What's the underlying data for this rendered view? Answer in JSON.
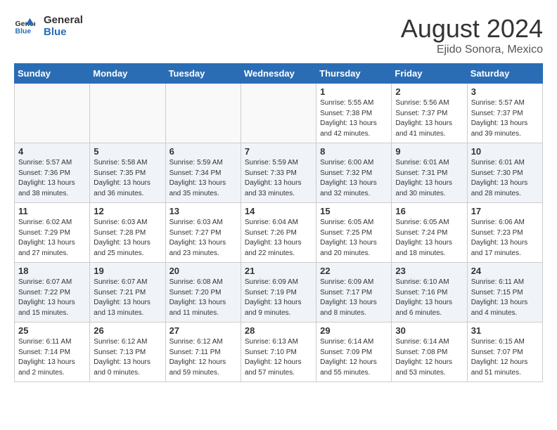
{
  "header": {
    "logo_line1": "General",
    "logo_line2": "Blue",
    "month_year": "August 2024",
    "location": "Ejido Sonora, Mexico"
  },
  "days_of_week": [
    "Sunday",
    "Monday",
    "Tuesday",
    "Wednesday",
    "Thursday",
    "Friday",
    "Saturday"
  ],
  "weeks": [
    [
      {
        "day": "",
        "info": ""
      },
      {
        "day": "",
        "info": ""
      },
      {
        "day": "",
        "info": ""
      },
      {
        "day": "",
        "info": ""
      },
      {
        "day": "1",
        "info": "Sunrise: 5:55 AM\nSunset: 7:38 PM\nDaylight: 13 hours\nand 42 minutes."
      },
      {
        "day": "2",
        "info": "Sunrise: 5:56 AM\nSunset: 7:37 PM\nDaylight: 13 hours\nand 41 minutes."
      },
      {
        "day": "3",
        "info": "Sunrise: 5:57 AM\nSunset: 7:37 PM\nDaylight: 13 hours\nand 39 minutes."
      }
    ],
    [
      {
        "day": "4",
        "info": "Sunrise: 5:57 AM\nSunset: 7:36 PM\nDaylight: 13 hours\nand 38 minutes."
      },
      {
        "day": "5",
        "info": "Sunrise: 5:58 AM\nSunset: 7:35 PM\nDaylight: 13 hours\nand 36 minutes."
      },
      {
        "day": "6",
        "info": "Sunrise: 5:59 AM\nSunset: 7:34 PM\nDaylight: 13 hours\nand 35 minutes."
      },
      {
        "day": "7",
        "info": "Sunrise: 5:59 AM\nSunset: 7:33 PM\nDaylight: 13 hours\nand 33 minutes."
      },
      {
        "day": "8",
        "info": "Sunrise: 6:00 AM\nSunset: 7:32 PM\nDaylight: 13 hours\nand 32 minutes."
      },
      {
        "day": "9",
        "info": "Sunrise: 6:01 AM\nSunset: 7:31 PM\nDaylight: 13 hours\nand 30 minutes."
      },
      {
        "day": "10",
        "info": "Sunrise: 6:01 AM\nSunset: 7:30 PM\nDaylight: 13 hours\nand 28 minutes."
      }
    ],
    [
      {
        "day": "11",
        "info": "Sunrise: 6:02 AM\nSunset: 7:29 PM\nDaylight: 13 hours\nand 27 minutes."
      },
      {
        "day": "12",
        "info": "Sunrise: 6:03 AM\nSunset: 7:28 PM\nDaylight: 13 hours\nand 25 minutes."
      },
      {
        "day": "13",
        "info": "Sunrise: 6:03 AM\nSunset: 7:27 PM\nDaylight: 13 hours\nand 23 minutes."
      },
      {
        "day": "14",
        "info": "Sunrise: 6:04 AM\nSunset: 7:26 PM\nDaylight: 13 hours\nand 22 minutes."
      },
      {
        "day": "15",
        "info": "Sunrise: 6:05 AM\nSunset: 7:25 PM\nDaylight: 13 hours\nand 20 minutes."
      },
      {
        "day": "16",
        "info": "Sunrise: 6:05 AM\nSunset: 7:24 PM\nDaylight: 13 hours\nand 18 minutes."
      },
      {
        "day": "17",
        "info": "Sunrise: 6:06 AM\nSunset: 7:23 PM\nDaylight: 13 hours\nand 17 minutes."
      }
    ],
    [
      {
        "day": "18",
        "info": "Sunrise: 6:07 AM\nSunset: 7:22 PM\nDaylight: 13 hours\nand 15 minutes."
      },
      {
        "day": "19",
        "info": "Sunrise: 6:07 AM\nSunset: 7:21 PM\nDaylight: 13 hours\nand 13 minutes."
      },
      {
        "day": "20",
        "info": "Sunrise: 6:08 AM\nSunset: 7:20 PM\nDaylight: 13 hours\nand 11 minutes."
      },
      {
        "day": "21",
        "info": "Sunrise: 6:09 AM\nSunset: 7:19 PM\nDaylight: 13 hours\nand 9 minutes."
      },
      {
        "day": "22",
        "info": "Sunrise: 6:09 AM\nSunset: 7:17 PM\nDaylight: 13 hours\nand 8 minutes."
      },
      {
        "day": "23",
        "info": "Sunrise: 6:10 AM\nSunset: 7:16 PM\nDaylight: 13 hours\nand 6 minutes."
      },
      {
        "day": "24",
        "info": "Sunrise: 6:11 AM\nSunset: 7:15 PM\nDaylight: 13 hours\nand 4 minutes."
      }
    ],
    [
      {
        "day": "25",
        "info": "Sunrise: 6:11 AM\nSunset: 7:14 PM\nDaylight: 13 hours\nand 2 minutes."
      },
      {
        "day": "26",
        "info": "Sunrise: 6:12 AM\nSunset: 7:13 PM\nDaylight: 13 hours\nand 0 minutes."
      },
      {
        "day": "27",
        "info": "Sunrise: 6:12 AM\nSunset: 7:11 PM\nDaylight: 12 hours\nand 59 minutes."
      },
      {
        "day": "28",
        "info": "Sunrise: 6:13 AM\nSunset: 7:10 PM\nDaylight: 12 hours\nand 57 minutes."
      },
      {
        "day": "29",
        "info": "Sunrise: 6:14 AM\nSunset: 7:09 PM\nDaylight: 12 hours\nand 55 minutes."
      },
      {
        "day": "30",
        "info": "Sunrise: 6:14 AM\nSunset: 7:08 PM\nDaylight: 12 hours\nand 53 minutes."
      },
      {
        "day": "31",
        "info": "Sunrise: 6:15 AM\nSunset: 7:07 PM\nDaylight: 12 hours\nand 51 minutes."
      }
    ]
  ]
}
